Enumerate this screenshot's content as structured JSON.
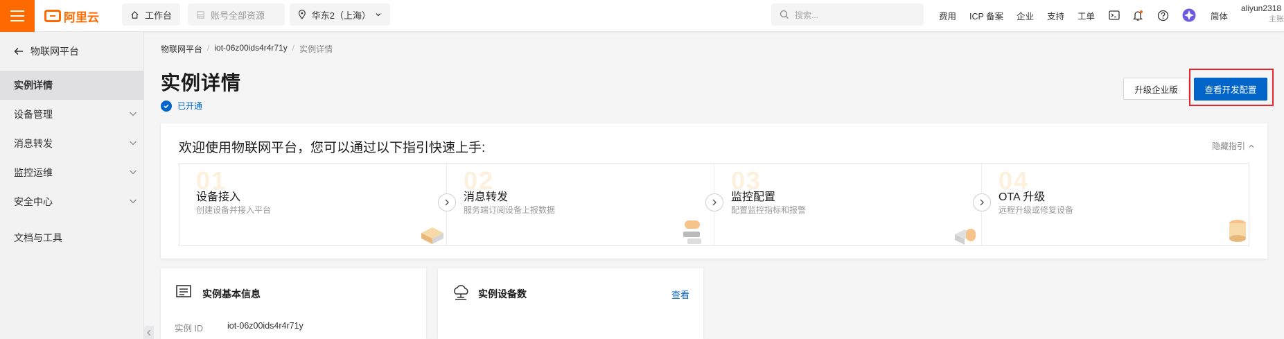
{
  "topbar": {
    "logo_text": "阿里云",
    "workbench": "工作台",
    "account_scope": "账号全部资源",
    "region": "华东2（上海）",
    "search_placeholder": "搜索...",
    "links": [
      "费用",
      "ICP 备案",
      "企业",
      "支持",
      "工单"
    ],
    "lang": "简体",
    "user_name": "aliyun2318",
    "user_sub": "主账"
  },
  "sidebar": {
    "back_label": "物联网平台",
    "items": [
      {
        "label": "实例详情",
        "active": true,
        "expandable": false
      },
      {
        "label": "设备管理",
        "active": false,
        "expandable": true
      },
      {
        "label": "消息转发",
        "active": false,
        "expandable": true
      },
      {
        "label": "监控运维",
        "active": false,
        "expandable": true
      },
      {
        "label": "安全中心",
        "active": false,
        "expandable": true
      },
      {
        "label": "文档与工具",
        "active": false,
        "expandable": false
      }
    ]
  },
  "breadcrumb": {
    "items": [
      "物联网平台",
      "iot-06z00ids4r4r71y",
      "实例详情"
    ],
    "separator": "/"
  },
  "page": {
    "title": "实例详情",
    "status": "已开通",
    "btn_upgrade": "升级企业版",
    "btn_dev_config": "查看开发配置"
  },
  "guide": {
    "title": "欢迎使用物联网平台，您可以通过以下指引快速上手:",
    "hide_label": "隐藏指引",
    "steps": [
      {
        "num": "01",
        "title": "设备接入",
        "desc": "创建设备并接入平台"
      },
      {
        "num": "02",
        "title": "消息转发",
        "desc": "服务端订阅设备上报数据"
      },
      {
        "num": "03",
        "title": "监控配置",
        "desc": "配置监控指标和报警"
      },
      {
        "num": "04",
        "title": "OTA 升级",
        "desc": "远程升级或修复设备"
      }
    ]
  },
  "basic_info": {
    "title": "实例基本信息",
    "id_label": "实例 ID",
    "id_value": "iot-06z00ids4r4r71y"
  },
  "device_count": {
    "title": "实例设备数",
    "link": "查看"
  },
  "colors": {
    "brand": "#ff6a00",
    "primary": "#0064c8",
    "highlight": "#e8242c"
  }
}
